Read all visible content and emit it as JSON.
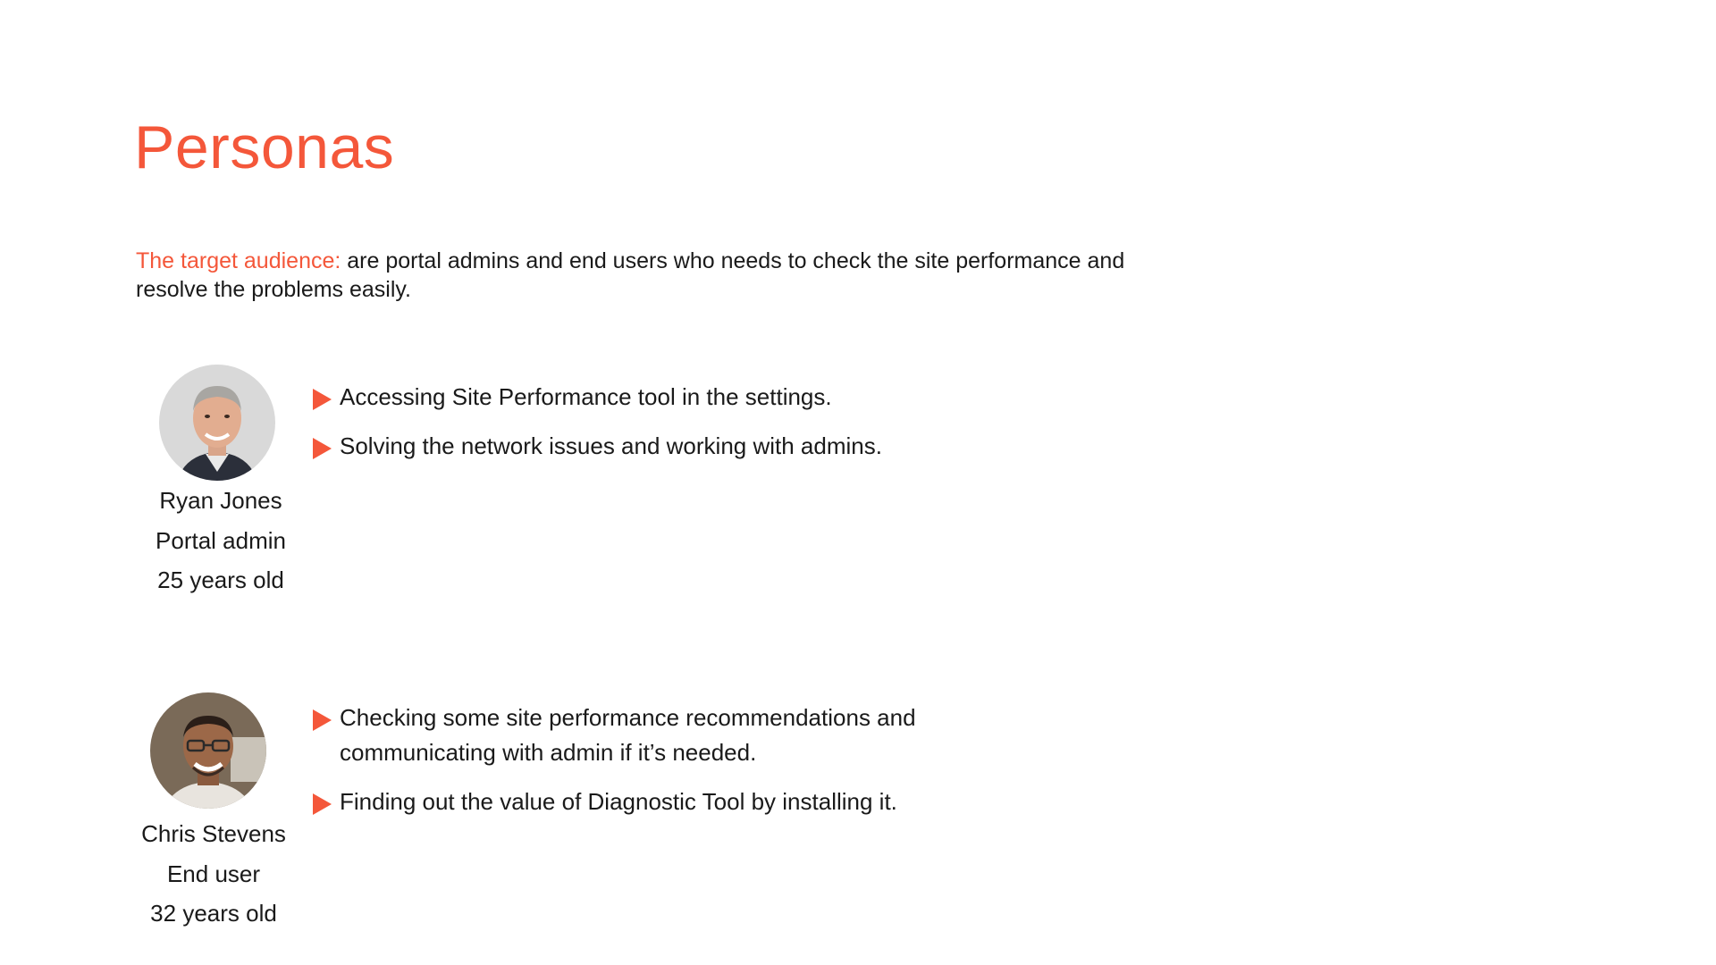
{
  "page": {
    "title": "Personas",
    "intro_label": "The target audience:",
    "intro_text": " are portal admins and end users who needs to check the site performance and resolve the problems easily."
  },
  "colors": {
    "accent": "#f4573a",
    "text": "#1a1a1a",
    "background": "#ffffff"
  },
  "personas": [
    {
      "avatar": "portrait-older-man",
      "name": "Ryan Jones",
      "role": "Portal admin",
      "age": "25 years old",
      "bullets": [
        "Accessing Site Performance tool in the settings.",
        "Solving the network issues and working with admins."
      ]
    },
    {
      "avatar": "portrait-man-glasses",
      "name": "Chris Stevens",
      "role": "End user",
      "age": "32 years old",
      "bullets": [
        "Checking some site performance recommendations and communicating with admin if it’s needed.",
        "Finding out the value of Diagnostic Tool by installing it."
      ]
    }
  ]
}
